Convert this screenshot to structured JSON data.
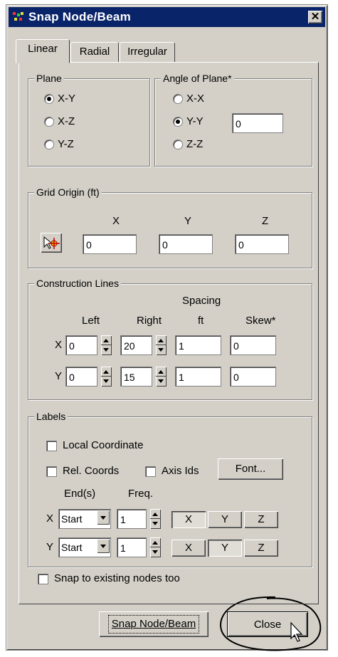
{
  "window": {
    "title": "Snap Node/Beam",
    "close_glyph": "✕"
  },
  "tabs": [
    {
      "label": "Linear",
      "active": true
    },
    {
      "label": "Radial",
      "active": false
    },
    {
      "label": "Irregular",
      "active": false
    }
  ],
  "plane": {
    "legend": "Plane",
    "options": [
      {
        "label": "X-Y",
        "checked": true
      },
      {
        "label": "X-Z",
        "checked": false
      },
      {
        "label": "Y-Z",
        "checked": false
      }
    ]
  },
  "angle": {
    "legend": "Angle of Plane*",
    "options": [
      {
        "label": "X-X",
        "checked": false
      },
      {
        "label": "Y-Y",
        "checked": true
      },
      {
        "label": "Z-Z",
        "checked": false
      }
    ],
    "value": "0"
  },
  "grid_origin": {
    "legend": "Grid Origin (ft)",
    "x_label": "X",
    "y_label": "Y",
    "z_label": "Z",
    "x": "0",
    "y": "0",
    "z": "0"
  },
  "construction": {
    "legend": "Construction Lines",
    "headers": {
      "left": "Left",
      "right": "Right",
      "spacing": "Spacing",
      "spacing_unit": "ft",
      "skew": "Skew*"
    },
    "rows": [
      {
        "label": "X",
        "left": "0",
        "right": "20",
        "spacing": "1",
        "skew": "0"
      },
      {
        "label": "Y",
        "left": "0",
        "right": "15",
        "spacing": "1",
        "skew": "0"
      }
    ]
  },
  "labels": {
    "legend": "Labels",
    "local_coordinate": "Local Coordinate",
    "rel_coords": "Rel. Coords",
    "axis_ids": "Axis Ids",
    "font_button": "Font...",
    "ends_header": "End(s)",
    "freq_header": "Freq.",
    "rows": [
      {
        "label": "X",
        "end": "Start",
        "freq": "1",
        "x": "X",
        "y": "Y",
        "z": "Z"
      },
      {
        "label": "Y",
        "end": "Start",
        "freq": "1",
        "x": "X",
        "y": "Y",
        "z": "Z"
      }
    ]
  },
  "snap_existing": "Snap to existing nodes too",
  "buttons": {
    "snap": "Snap Node/Beam",
    "close": "Close"
  }
}
